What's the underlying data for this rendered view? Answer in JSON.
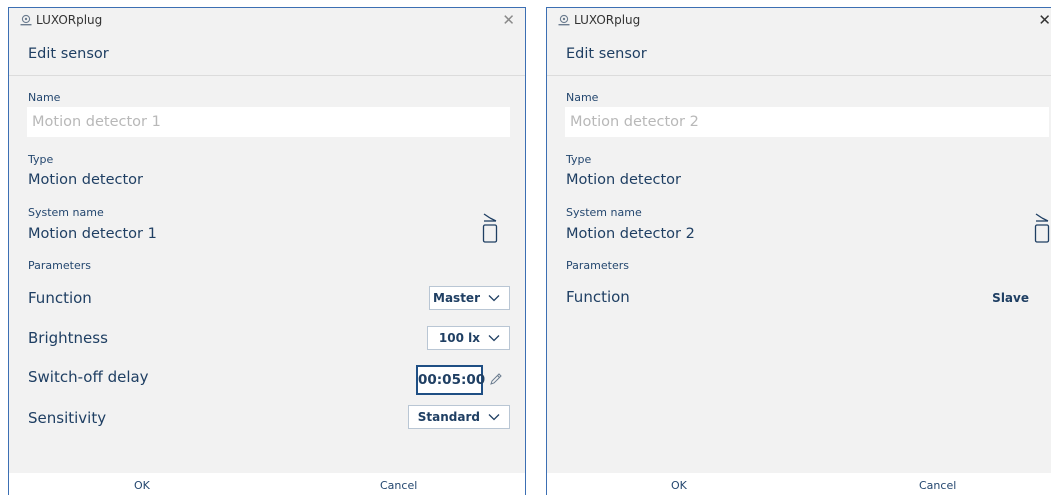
{
  "window_left": {
    "app_title": "LUXORplug",
    "heading": "Edit sensor",
    "name_label": "Name",
    "name_placeholder": "Motion detector 1",
    "type_label": "Type",
    "type_value": "Motion detector",
    "system_name_label": "System name",
    "system_name_value": "Motion detector 1",
    "parameters_label": "Parameters",
    "function_label": "Function",
    "function_value": "Master",
    "brightness_label": "Brightness",
    "brightness_value": "100 lx",
    "switch_off_delay_label": "Switch-off delay",
    "switch_off_delay_value": "00:05:00",
    "sensitivity_label": "Sensitivity",
    "sensitivity_value": "Standard",
    "ok_label": "OK",
    "cancel_label": "Cancel"
  },
  "window_right": {
    "app_title": "LUXORplug",
    "heading": "Edit sensor",
    "name_label": "Name",
    "name_placeholder": "Motion detector 2",
    "type_label": "Type",
    "type_value": "Motion detector",
    "system_name_label": "System name",
    "system_name_value": "Motion detector 2",
    "parameters_label": "Parameters",
    "function_label": "Function",
    "function_value": "Slave",
    "ok_label": "OK",
    "cancel_label": "Cancel"
  },
  "icons": {
    "app": "luxorplug-logo-icon",
    "close": "close-icon",
    "sensor": "motion-sensor-icon",
    "dropdown": "chevron-down-icon",
    "edit": "pencil-icon"
  },
  "colors": {
    "window_background": "#f2f2f2",
    "window_border": "#3c6fb3",
    "text_primary": "#1f3f63",
    "placeholder": "#b8b8b8",
    "input_background": "#ffffff"
  }
}
